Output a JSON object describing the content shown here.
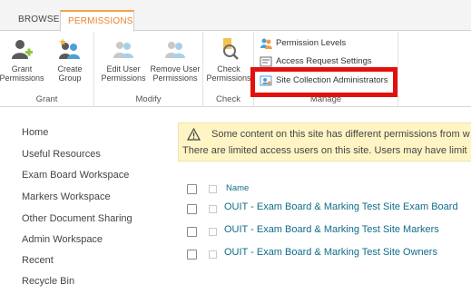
{
  "tabs": {
    "browse": "BROWSE",
    "permissions": "PERMISSIONS"
  },
  "ribbon": {
    "grant": {
      "label": "Grant",
      "grant_permissions": "Grant Permissions",
      "create_group": "Create Group"
    },
    "modify": {
      "label": "Modify",
      "edit_user_permissions": "Edit User Permissions",
      "remove_user_permissions": "Remove User Permissions"
    },
    "check": {
      "label": "Check",
      "check_permissions": "Check Permissions"
    },
    "manage": {
      "label": "Manage",
      "permission_levels": "Permission Levels",
      "access_request_settings": "Access Request Settings",
      "site_collection_administrators": "Site Collection Administrators"
    }
  },
  "nav": [
    "Home",
    "Useful Resources",
    "Exam Board Workspace",
    "Markers Workspace",
    "Other Document Sharing",
    "Admin Workspace",
    "Recent",
    "Recycle Bin"
  ],
  "alert": {
    "line1": "Some content on this site has different permissions from w",
    "line2": "There are limited access users on this site. Users may have limit"
  },
  "list": {
    "header": "Name",
    "rows": [
      "OUIT - Exam Board & Marking Test Site Exam Board",
      "OUIT - Exam Board & Marking Test Site Markers",
      "OUIT - Exam Board & Marking Test Site Owners"
    ]
  },
  "colors": {
    "accent": "#f07f2b",
    "highlight": "#e3100e",
    "link": "#0f6c8a",
    "alert_bg": "#fff5c4"
  }
}
